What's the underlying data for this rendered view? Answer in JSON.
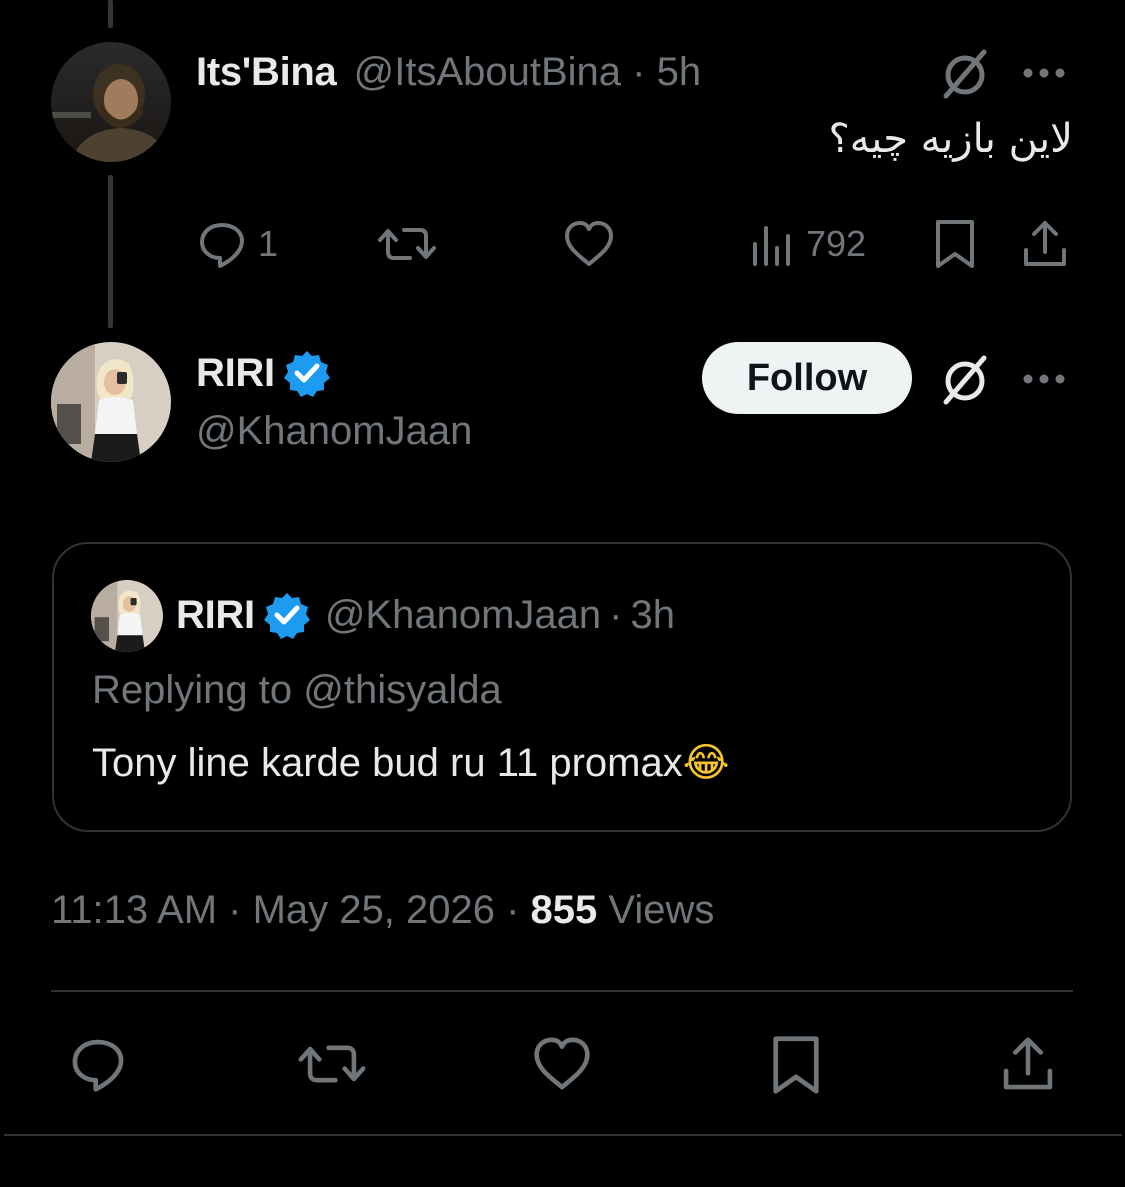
{
  "reply_tweet": {
    "display_name": "Its'Bina",
    "handle": "@ItsAboutBina",
    "separator": "·",
    "time": "5h",
    "text": "لاین بازیه چیه؟",
    "reply_count": "1",
    "view_count": "792"
  },
  "main_tweet": {
    "display_name": "RIRI",
    "handle": "@KhanomJaan",
    "follow_label": "Follow",
    "timestamp": "11:13 AM · May 25, 2026 · ",
    "views_number": "855",
    "views_label": " Views"
  },
  "quoted_tweet": {
    "display_name": "RIRI",
    "handle": "@KhanomJaan",
    "separator": "·",
    "time": "3h",
    "replying_to": "Replying to @thisyalda",
    "text": "Tony line karde bud ru 11 promax",
    "emoji": "😂"
  },
  "colors": {
    "background": "#000000",
    "text_primary": "#e7e9ea",
    "text_muted": "#71767b",
    "verified": "#1d9bf0",
    "follow_bg": "#eff3f4",
    "border": "#2f3336"
  },
  "icons": [
    "grok-icon",
    "more-icon",
    "reply-icon",
    "retweet-icon",
    "like-icon",
    "views-icon",
    "bookmark-icon",
    "share-icon",
    "verified-icon"
  ]
}
